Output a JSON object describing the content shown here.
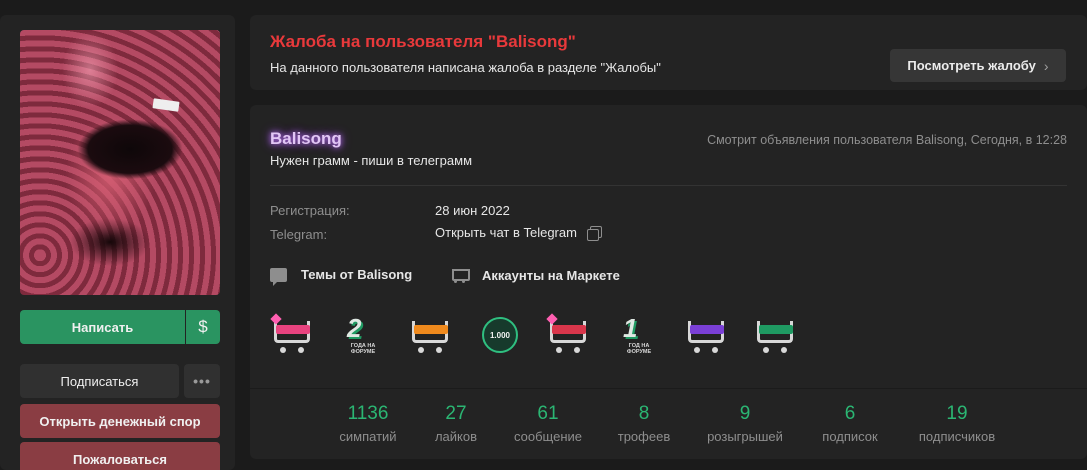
{
  "sidebar": {
    "write_button": "Написать",
    "dollar_icon": "$",
    "subscribe_button": "Подписаться",
    "more_icon": "•••",
    "dispute_button": "Открыть денежный спор",
    "report_button": "Пожаловаться"
  },
  "complaint": {
    "title": "Жалоба на пользователя \"Balisong\"",
    "text": "На данного пользователя написана жалоба в разделе \"Жалобы\"",
    "view_button": "Посмотреть жалобу",
    "view_chevron": "›"
  },
  "profile": {
    "username": "Balisong",
    "status": "Нужен грамм - пиши в телеграмм",
    "activity": "Смотрит объявления пользователя Balisong, Сегодня, в 12:28",
    "registration_label": "Регистрация:",
    "registration_value": "28 июн 2022",
    "telegram_label": "Telegram:",
    "telegram_value": "Открыть чат в Telegram",
    "themes_link": "Темы от Balisong",
    "market_link": "Аккаунты на Маркете"
  },
  "trophies": {
    "two_years_num": "2",
    "two_years_text": "ГОДА НА ФОРУМЕ",
    "thousand_badge": "1.000",
    "one_year_num": "1",
    "one_year_text": "ГОД НА ФОРУМЕ"
  },
  "stats": [
    {
      "value": "1136",
      "label": "симпатий"
    },
    {
      "value": "27",
      "label": "лайков"
    },
    {
      "value": "61",
      "label": "сообщение"
    },
    {
      "value": "8",
      "label": "трофеев"
    },
    {
      "value": "9",
      "label": "розыгрышей"
    },
    {
      "value": "6",
      "label": "подписок"
    },
    {
      "value": "19",
      "label": "подписчиков"
    }
  ],
  "colors": {
    "accent_green": "#2a9461",
    "danger": "#e8393b",
    "stat_green": "#2bb673",
    "username_glow": "#b070e8"
  }
}
